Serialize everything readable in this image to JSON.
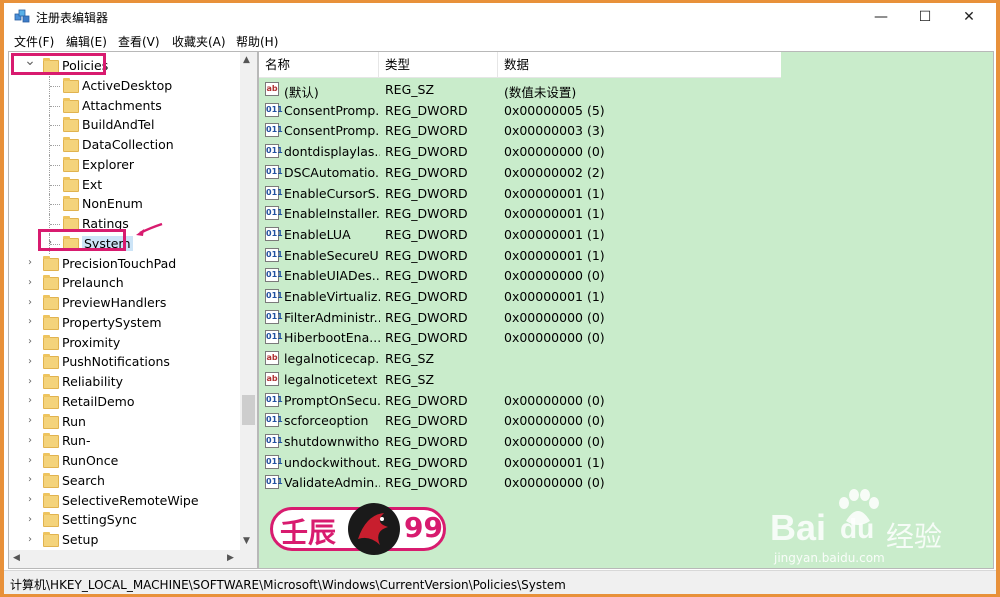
{
  "window": {
    "title": "注册表编辑器",
    "icon": "regedit-icon"
  },
  "controls": {
    "minimize": "—",
    "maximize": "☐",
    "close": "✕"
  },
  "menu": [
    "文件(F)",
    "编辑(E)",
    "查看(V)",
    "收藏夹(A)",
    "帮助(H)"
  ],
  "tree": {
    "items": [
      {
        "label": "Policies",
        "level": 0,
        "expanded": true
      },
      {
        "label": "ActiveDesktop",
        "level": 1
      },
      {
        "label": "Attachments",
        "level": 1
      },
      {
        "label": "BuildAndTel",
        "level": 1
      },
      {
        "label": "DataCollection",
        "level": 1
      },
      {
        "label": "Explorer",
        "level": 1
      },
      {
        "label": "Ext",
        "level": 1
      },
      {
        "label": "NonEnum",
        "level": 1
      },
      {
        "label": "Ratings",
        "level": 1
      },
      {
        "label": "System",
        "level": 1,
        "selected": true
      },
      {
        "label": "PrecisionTouchPad",
        "level": 0
      },
      {
        "label": "Prelaunch",
        "level": 0
      },
      {
        "label": "PreviewHandlers",
        "level": 0
      },
      {
        "label": "PropertySystem",
        "level": 0
      },
      {
        "label": "Proximity",
        "level": 0
      },
      {
        "label": "PushNotifications",
        "level": 0
      },
      {
        "label": "Reliability",
        "level": 0
      },
      {
        "label": "RetailDemo",
        "level": 0
      },
      {
        "label": "Run",
        "level": 0
      },
      {
        "label": "Run-",
        "level": 0
      },
      {
        "label": "RunOnce",
        "level": 0
      },
      {
        "label": "Search",
        "level": 0
      },
      {
        "label": "SelectiveRemoteWipe",
        "level": 0
      },
      {
        "label": "SettingSync",
        "level": 0
      },
      {
        "label": "Setup",
        "level": 0
      }
    ]
  },
  "columns": {
    "name": "名称",
    "type": "类型",
    "data": "数据"
  },
  "values": [
    {
      "icon": "ab",
      "name": "(默认)",
      "type": "REG_SZ",
      "data": "(数值未设置)"
    },
    {
      "icon": "dword",
      "name": "ConsentPromp...",
      "type": "REG_DWORD",
      "data": "0x00000005 (5)"
    },
    {
      "icon": "dword",
      "name": "ConsentPromp...",
      "type": "REG_DWORD",
      "data": "0x00000003 (3)"
    },
    {
      "icon": "dword",
      "name": "dontdisplaylas...",
      "type": "REG_DWORD",
      "data": "0x00000000 (0)"
    },
    {
      "icon": "dword",
      "name": "DSCAutomatio...",
      "type": "REG_DWORD",
      "data": "0x00000002 (2)"
    },
    {
      "icon": "dword",
      "name": "EnableCursorS...",
      "type": "REG_DWORD",
      "data": "0x00000001 (1)"
    },
    {
      "icon": "dword",
      "name": "EnableInstaller...",
      "type": "REG_DWORD",
      "data": "0x00000001 (1)"
    },
    {
      "icon": "dword",
      "name": "EnableLUA",
      "type": "REG_DWORD",
      "data": "0x00000001 (1)"
    },
    {
      "icon": "dword",
      "name": "EnableSecureU...",
      "type": "REG_DWORD",
      "data": "0x00000001 (1)"
    },
    {
      "icon": "dword",
      "name": "EnableUIADes...",
      "type": "REG_DWORD",
      "data": "0x00000000 (0)"
    },
    {
      "icon": "dword",
      "name": "EnableVirtualiz...",
      "type": "REG_DWORD",
      "data": "0x00000001 (1)"
    },
    {
      "icon": "dword",
      "name": "FilterAdministr...",
      "type": "REG_DWORD",
      "data": "0x00000000 (0)"
    },
    {
      "icon": "dword",
      "name": "HiberbootEna...",
      "type": "REG_DWORD",
      "data": "0x00000000 (0)"
    },
    {
      "icon": "ab",
      "name": "legalnoticecap...",
      "type": "REG_SZ",
      "data": ""
    },
    {
      "icon": "ab",
      "name": "legalnoticetext",
      "type": "REG_SZ",
      "data": ""
    },
    {
      "icon": "dword",
      "name": "PromptOnSecu...",
      "type": "REG_DWORD",
      "data": "0x00000000 (0)"
    },
    {
      "icon": "dword",
      "name": "scforceoption",
      "type": "REG_DWORD",
      "data": "0x00000000 (0)"
    },
    {
      "icon": "dword",
      "name": "shutdownwitho...",
      "type": "REG_DWORD",
      "data": "0x00000000 (0)"
    },
    {
      "icon": "dword",
      "name": "undockwithout...",
      "type": "REG_DWORD",
      "data": "0x00000001 (1)"
    },
    {
      "icon": "dword",
      "name": "ValidateAdmin...",
      "type": "REG_DWORD",
      "data": "0x00000000 (0)"
    }
  ],
  "status": "计算机\\HKEY_LOCAL_MACHINE\\SOFTWARE\\Microsoft\\Windows\\CurrentVersion\\Policies\\System",
  "brand": {
    "left": "壬辰",
    "right": "99"
  },
  "watermark": {
    "main": "Bai",
    "du": "du",
    "cn": "经验",
    "url": "jingyan.baidu.com"
  },
  "colors": {
    "accent_highlight": "#d81b6f",
    "pane_bg": "#c9eccb",
    "border_frame": "#e8913a"
  }
}
